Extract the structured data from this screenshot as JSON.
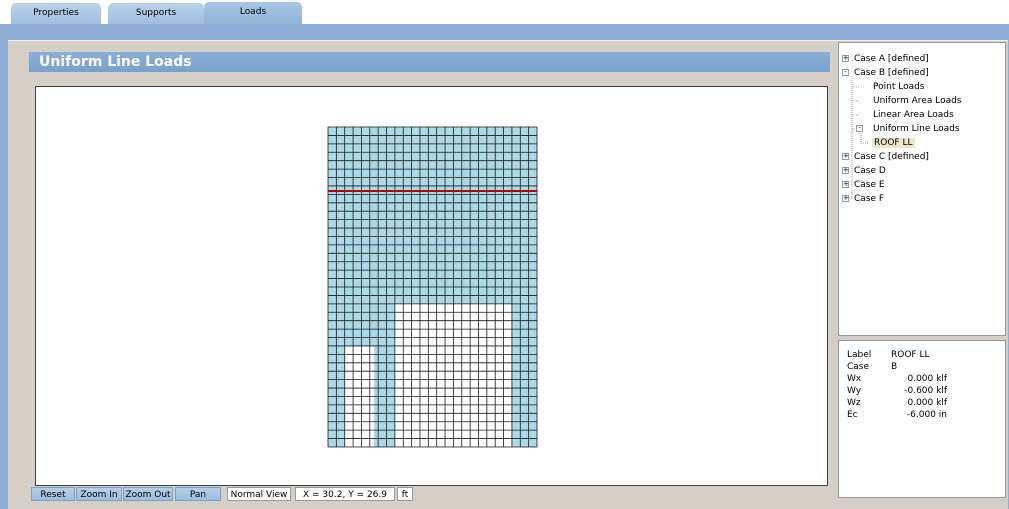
{
  "tabs": [
    {
      "label": "Properties",
      "active": false
    },
    {
      "label": "Supports",
      "active": false
    },
    {
      "label": "Loads",
      "active": true
    }
  ],
  "panel": {
    "title": "Uniform Line Loads"
  },
  "tree": {
    "nodes": [
      {
        "label": "Case A [defined]",
        "expander": "+"
      },
      {
        "label": "Case B [defined]",
        "expander": "-"
      },
      {
        "label": "Point Loads"
      },
      {
        "label": "Uniform Area Loads"
      },
      {
        "label": "Linear Area Loads"
      },
      {
        "label": "Uniform Line Loads",
        "expander": "-"
      },
      {
        "label": "ROOF LL",
        "selected": true
      },
      {
        "label": "Case C [defined]",
        "expander": "+"
      },
      {
        "label": "Case D",
        "expander": "+"
      },
      {
        "label": "Case E",
        "expander": "+"
      },
      {
        "label": "Case F",
        "expander": "+"
      }
    ]
  },
  "properties": [
    {
      "key": "Label",
      "value": "ROOF LL"
    },
    {
      "key": "Case",
      "value": "B"
    },
    {
      "key": "Wx",
      "value": "0.000 klf"
    },
    {
      "key": "Wy",
      "value": "-0.600 klf"
    },
    {
      "key": "Wz",
      "value": "0.000 klf"
    },
    {
      "key": "Ec",
      "value": "-6.000 in"
    }
  ],
  "statusbar": {
    "reset": "Reset",
    "zoom_in": "Zoom In",
    "zoom_out": "Zoom Out",
    "pan": "Pan",
    "view_mode": "Normal View",
    "coords": "X = 30.2, Y = 26.9",
    "units": "ft"
  },
  "colors": {
    "tab_bar": "#8fb1d9",
    "grid_fill": "#add8e6",
    "load_line": "#b00000",
    "panel_title_bg": "#7aa1cd"
  }
}
